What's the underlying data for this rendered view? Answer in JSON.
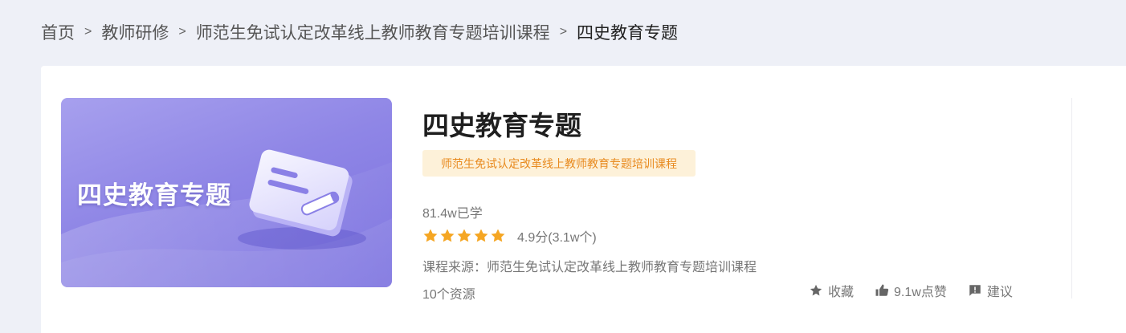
{
  "breadcrumb": [
    {
      "label": "首页"
    },
    {
      "label": "教师研修"
    },
    {
      "label": "师范生免试认定改革线上教师教育专题培训课程"
    },
    {
      "label": "四史教育专题"
    }
  ],
  "breadcrumb_separator": ">",
  "course": {
    "cover_title": "四史教育专题",
    "title": "四史教育专题",
    "tag": "师范生免试认定改革线上教师教育专题培训课程",
    "learners": "81.4w已学",
    "stars": 5,
    "score": "4.9分(3.1w个)",
    "source": "课程来源：师范生免试认定改革线上教师教育专题培训课程",
    "resources": "10个资源"
  },
  "actions": {
    "favorite": "收藏",
    "likes": "9.1w点赞",
    "feedback": "建议"
  },
  "colors": {
    "page_bg": "#eef0f7",
    "tag_bg": "#fdf1d9",
    "tag_text": "#e88a1f",
    "star": "#f5a623",
    "cover_gradient_start": "#a7a0ee",
    "cover_gradient_end": "#7a70df"
  },
  "icons": {
    "favorite": "star-icon",
    "likes": "thumbs-up-icon",
    "feedback": "feedback-icon"
  }
}
